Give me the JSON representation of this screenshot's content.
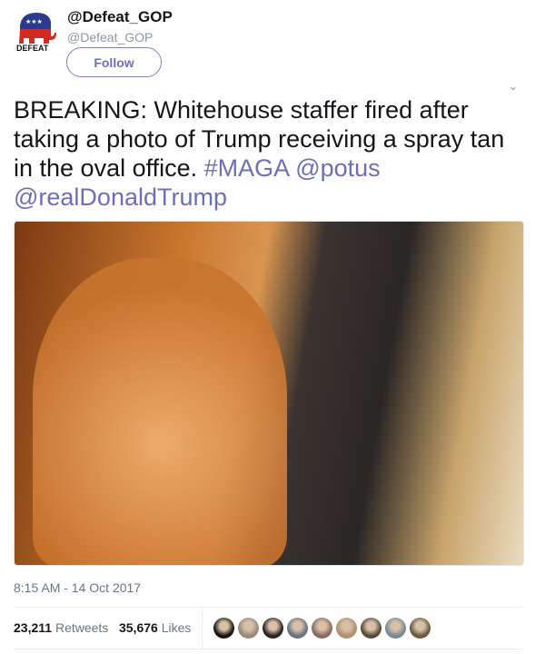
{
  "user": {
    "display_name": "@Defeat_GOP",
    "handle": "@Defeat_GOP",
    "avatar_text": "DEFEAT",
    "follow_label": "Follow"
  },
  "tweet": {
    "text": "BREAKING:  Whitehouse staffer fired after taking a photo of Trump receiving a spray tan in the oval office.",
    "hashtag": "#MAGA",
    "mention1": "@potus",
    "mention2": "@realDonaldTrump",
    "timestamp": "8:15 AM - 14 Oct 2017"
  },
  "stats": {
    "retweets_count": "23,211",
    "retweets_label": "Retweets",
    "likes_count": "35,676",
    "likes_label": "Likes"
  },
  "likers": [
    "#1a1410",
    "#9a8a7a",
    "#2a2420",
    "#6a7280",
    "#8a6a60",
    "#b09070",
    "#5a4a38",
    "#7a8a98",
    "#6a5a40"
  ],
  "colors": {
    "link": "#6b6fb8",
    "secondary": "#657786"
  }
}
